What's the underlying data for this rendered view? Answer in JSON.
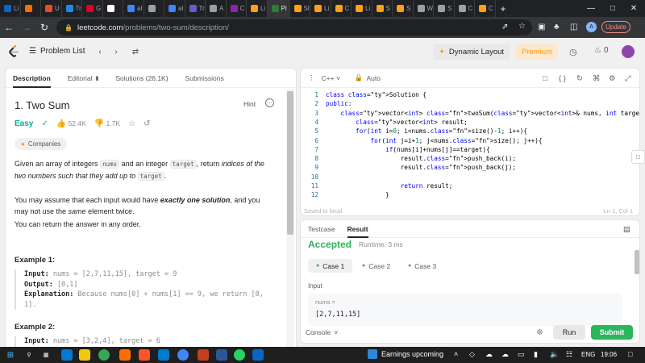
{
  "browser": {
    "tabs": [
      {
        "label": "Li",
        "color": "#0a66c2"
      },
      {
        "label": "",
        "color": "#ff6d00"
      },
      {
        "label": "U",
        "color": "#e44d26"
      },
      {
        "label": "Tr",
        "color": "#1e88e5"
      },
      {
        "label": "G",
        "color": "#e60023"
      },
      {
        "label": "",
        "color": "#ffffff"
      },
      {
        "label": "al",
        "color": "#4285f4"
      },
      {
        "label": "",
        "color": "#9aa0a6"
      },
      {
        "label": "al",
        "color": "#4285f4"
      },
      {
        "label": "Tr",
        "color": "#6a5acd"
      },
      {
        "label": "A",
        "color": "#9aa0a6"
      },
      {
        "label": "C",
        "color": "#8e24aa"
      },
      {
        "label": "Li",
        "color": "#ffa116"
      },
      {
        "label": "Pi",
        "color": "#2e7d32"
      },
      {
        "label": "Sl",
        "color": "#ffa116"
      },
      {
        "label": "Li",
        "color": "#ffa116"
      },
      {
        "label": "C",
        "color": "#ffa116"
      },
      {
        "label": "Li",
        "color": "#ffa116"
      },
      {
        "label": "S",
        "color": "#ffa116"
      },
      {
        "label": "S",
        "color": "#ffa116"
      },
      {
        "label": "W",
        "color": "#9aa0a6"
      },
      {
        "label": "S",
        "color": "#9aa0a6"
      },
      {
        "label": "C",
        "color": "#9aa0a6"
      },
      {
        "label": "C",
        "color": "#ffa116"
      }
    ],
    "active_tab_index": 13,
    "new_tab": "+",
    "url_host": "leetcode.com",
    "url_path": "/problems/two-sum/description/",
    "avatar_letter": "A",
    "update_label": "Update"
  },
  "lcnav": {
    "problem_list": "Problem List",
    "dynamic_layout": "Dynamic Layout",
    "premium": "Premium",
    "streak": "0"
  },
  "left": {
    "tabs": [
      {
        "label": "Description"
      },
      {
        "label": "Editorial"
      },
      {
        "label": "Solutions (26.1K)"
      },
      {
        "label": "Submissions"
      }
    ],
    "title": "1. Two Sum",
    "hint": "Hint",
    "difficulty": "Easy",
    "likes": "52.4K",
    "dislikes": "1.7K",
    "companies": "Companies",
    "p1_a": "Given an array of integers ",
    "p1_code1": "nums",
    "p1_b": " and an integer ",
    "p1_code2": "target",
    "p1_c": ", return ",
    "p1_i": "indices of the two numbers such that they add up to ",
    "p1_code3": "target",
    "p1_d": ".",
    "p2_a": "You may assume that each input would have ",
    "p2_b": "exactly one solution",
    "p2_c": ", and you may not use the ",
    "p2_i": "same",
    "p2_d": " element twice.",
    "p3": "You can return the answer in any order.",
    "ex1_title": "Example 1:",
    "ex1_input_label": "Input:",
    "ex1_input": "nums = [2,7,11,15], target = 9",
    "ex1_output_label": "Output:",
    "ex1_output": "[0,1]",
    "ex1_expl_label": "Explanation:",
    "ex1_expl": "Because nums[0] + nums[1] == 9, we return [0, 1].",
    "ex2_title": "Example 2:",
    "ex2_input_label": "Input:",
    "ex2_input": "nums = [3,2,4], target = 6"
  },
  "editor": {
    "language": "C++",
    "auto": "Auto",
    "code": [
      "class Solution {",
      "public:",
      "    vector<int> twoSum(vector<int>& nums, int target) {",
      "        vector<int> result;",
      "        for(int i=0; i<nums.size()-1; i++){",
      "            for(int j=i+1; j<nums.size(); j++){",
      "                if(nums[i]+nums[j]==target){",
      "                    result.push_back(i);",
      "                    result.push_back(j);",
      "",
      "                    return result;",
      "                }"
    ],
    "saved": "Saved to local",
    "cursor": "Ln 1, Col 1"
  },
  "result": {
    "tabs": [
      {
        "label": "Testcase"
      },
      {
        "label": "Result"
      }
    ],
    "status": "Accepted",
    "runtime": "Runtime: 3 ms",
    "cases": [
      {
        "label": "Case 1"
      },
      {
        "label": "Case 2"
      },
      {
        "label": "Case 3"
      }
    ],
    "input_label": "Input",
    "input_name": "nums =",
    "input_value": "[2,7,11,15]",
    "console": "Console",
    "run": "Run",
    "submit": "Submit"
  },
  "taskbar": {
    "weather": "Earnings upcoming",
    "lang": "ENG",
    "time": "19:06"
  },
  "colors": {
    "accepted": "#2db55d",
    "easy": "#00af9b",
    "premium": "#ffa116"
  }
}
